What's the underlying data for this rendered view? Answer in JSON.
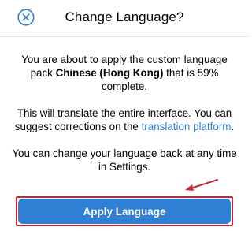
{
  "dialog": {
    "title": "Change Language?",
    "close_icon": "close-circle-icon"
  },
  "message": {
    "p1_before": "You are about to apply the custom language pack ",
    "p1_bold": "Chinese (Hong Kong)",
    "p1_after": " that is 59% complete.",
    "p2_before": "This will translate the entire interface. You can suggest corrections on the ",
    "p2_link": "translation platform",
    "p2_after": ".",
    "p3": "You can change your language back at any time in Settings."
  },
  "actions": {
    "apply_label": "Apply Language"
  },
  "colors": {
    "accent": "#2f7fd4",
    "link": "#2d7fd3",
    "annotation": "#cc2233"
  }
}
